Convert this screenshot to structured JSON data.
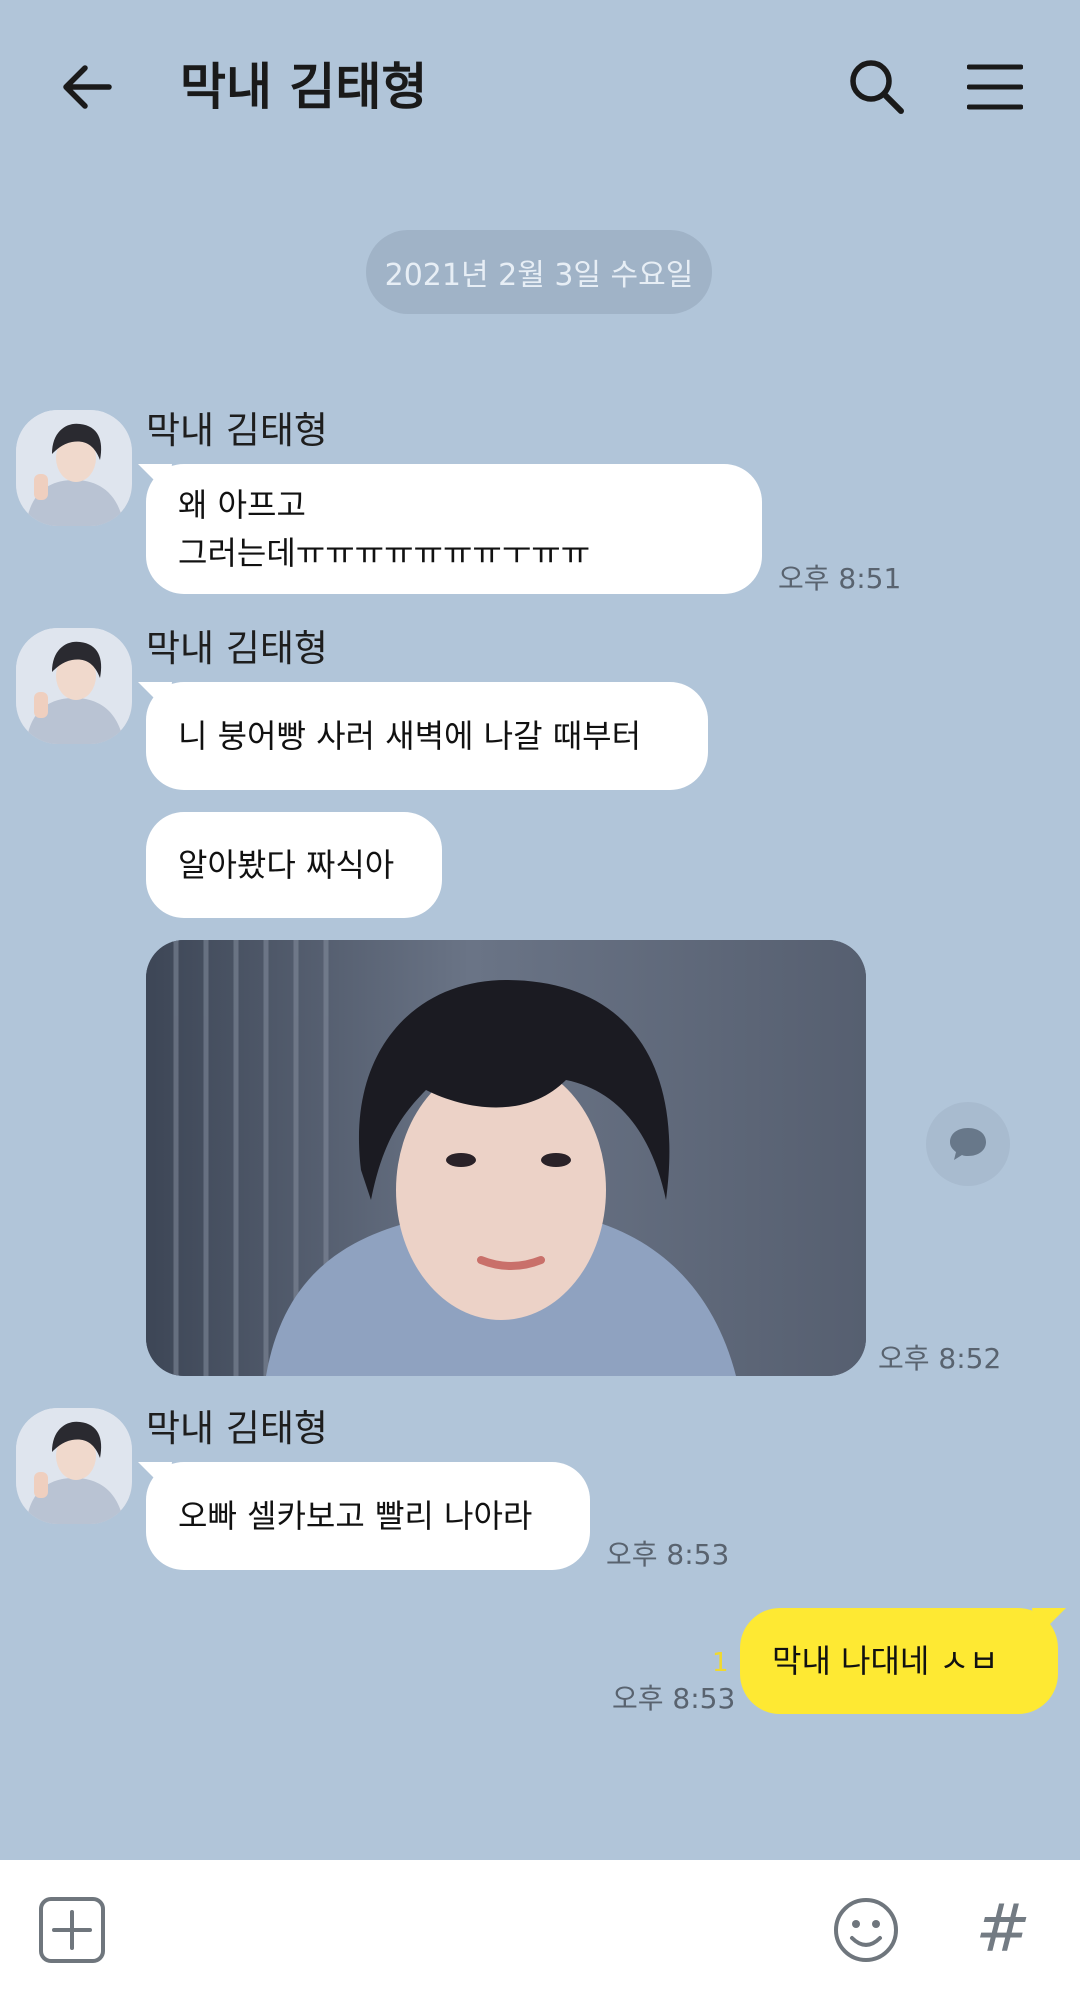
{
  "header": {
    "title": "막내 김태형"
  },
  "date_separator": "2021년 2월 3일 수요일",
  "messages": [
    {
      "sender": "막내 김태형",
      "line1": "왜 아프고",
      "line2": "그러는데ㅠㅠㅠㅠㅠㅠㅠㅜㅠㅠ",
      "time": "오후 8:51"
    },
    {
      "sender": "막내 김태형",
      "text": "니 붕어빵 사러 새벽에 나갈 때부터"
    },
    {
      "text": "알아봤다 짜식아"
    },
    {
      "time": "오후 8:52"
    },
    {
      "sender": "막내 김태형",
      "text": "오빠 셀카보고 빨리 나아라",
      "time": "오후 8:53"
    }
  ],
  "my_message": {
    "text": "막내 나대네 ㅅㅂ",
    "unread": "1",
    "time": "오후 8:53"
  },
  "colors": {
    "background": "#b1c5d9",
    "my_bubble": "#fee933",
    "their_bubble": "#ffffff"
  },
  "icons": [
    "back-arrow-icon",
    "search-icon",
    "menu-icon",
    "comment-icon",
    "plus-icon",
    "emoji-icon"
  ],
  "input": {
    "hashtag_label": "#"
  }
}
